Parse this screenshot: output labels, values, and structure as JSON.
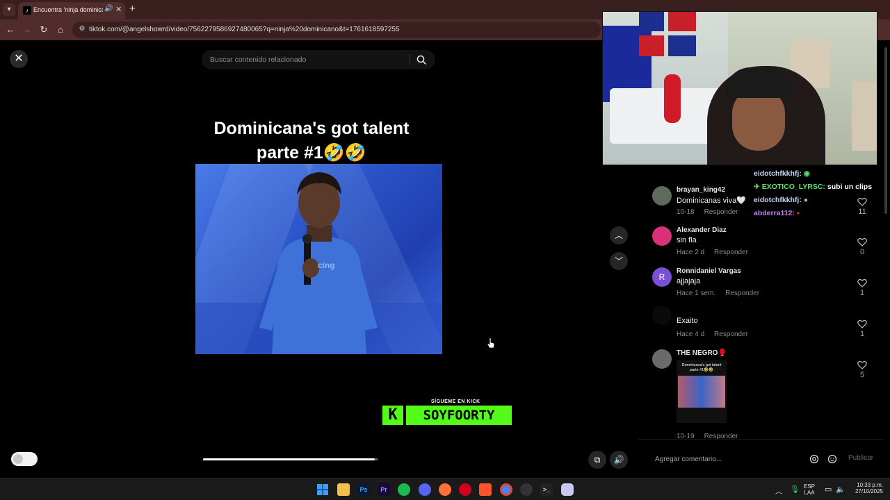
{
  "browser": {
    "tab_title": "Encuentra 'ninja dominicano'",
    "url": "tiktok.com/@angelshowrd/video/7562279586927480065?q=ninja%20dominicano&t=1761618597255"
  },
  "search": {
    "placeholder": "Buscar contenido relacionado"
  },
  "video": {
    "caption_line1": "Dominicana's got talent",
    "caption_line2": "parte #1🤣🤣",
    "progress": 0.98
  },
  "overlay": {
    "follow_text": "SÍGUEME EN KICK",
    "kick_letter": "K",
    "channel": "SOYFOORTY",
    "chat": [
      {
        "user": "eidotchfkkhfj:",
        "text": "",
        "color": "#c9d7ff"
      },
      {
        "user": "✈ EXOTICO_LYRSC:",
        "text": "subi un clips",
        "color": "#64e06c"
      },
      {
        "user": "eidotchfkkhfj:",
        "text": "",
        "color": "#c9d7ff"
      },
      {
        "user": "abderra112:",
        "text": "",
        "color": "#c67bff"
      }
    ]
  },
  "comments": [
    {
      "user": "brayan_king42",
      "text": "Dominicanas viva🤍",
      "date": "10-18",
      "reply": "Responder",
      "likes": "11",
      "avatar_color": "#5f6b5a",
      "avatar_letter": ""
    },
    {
      "user": "Alexander Diaz",
      "text": "sin fla",
      "date": "Hace 2 d",
      "reply": "Responder",
      "likes": "0",
      "avatar_color": "#d8307a",
      "avatar_letter": ""
    },
    {
      "user": "Ronnidaniel Vargas",
      "text": "ajjajaja",
      "date": "Hace 1 sem.",
      "reply": "Responder",
      "likes": "1",
      "avatar_color": "#7b4fd6",
      "avatar_letter": "R"
    },
    {
      "user": "",
      "text": "Exaito",
      "date": "Hace 4 d",
      "reply": "Responder",
      "likes": "1",
      "avatar_color": "#0a0a0a",
      "avatar_letter": ""
    },
    {
      "user": "THE NEGRO🥊",
      "text": "",
      "date": "10-19",
      "reply": "Responder",
      "likes": "5",
      "avatar_color": "#6a6a6a",
      "avatar_letter": ""
    }
  ],
  "thumb_caption": "Dominicana's got talent parte #1🤣🤣",
  "comment_box": {
    "placeholder": "Agregar comentario...",
    "publish": "Publicar"
  },
  "taskbar": {
    "lang_line1": "ESP",
    "lang_line2": "LAA",
    "time": "10:33 p.m.",
    "date": "27/10/2025"
  },
  "colors": {
    "kick_green": "#53fc18",
    "chrome": "#512c2c"
  }
}
